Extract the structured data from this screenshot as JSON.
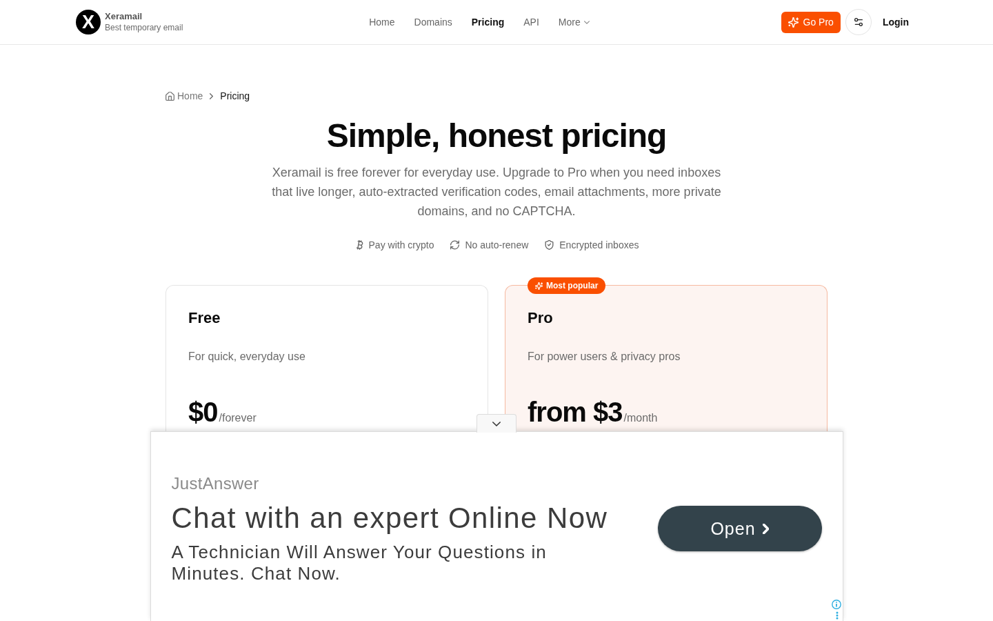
{
  "header": {
    "brand": {
      "logo_letter": "X",
      "name": "Xeramail",
      "tagline": "Best temporary email"
    },
    "nav": [
      {
        "label": "Home",
        "selected": false,
        "kind": "link"
      },
      {
        "label": "Domains",
        "selected": false,
        "kind": "link"
      },
      {
        "label": "Pricing",
        "selected": true,
        "kind": "link"
      },
      {
        "label": "API",
        "selected": false,
        "kind": "link"
      },
      {
        "label": "More",
        "selected": false,
        "kind": "dropdown"
      }
    ],
    "go_pro_button": "Go Pro",
    "login_button": "Login"
  },
  "breadcrumb": [
    {
      "label": "Home",
      "kind": "home"
    },
    {
      "label": "Pricing",
      "kind": "current"
    }
  ],
  "hero": {
    "title": "Simple, honest pricing",
    "description": "Xeramail is free forever for everyday use. Upgrade to Pro when you need inboxes that live longer, auto-extracted verification codes, email attachments, more private domains, and no CAPTCHA."
  },
  "features": [
    {
      "label": "Pay with crypto",
      "kind": "crypto"
    },
    {
      "label": "No auto-renew",
      "kind": "renewal"
    },
    {
      "label": "Encrypted inboxes",
      "kind": "security"
    }
  ],
  "plans": [
    {
      "name": "Free",
      "description": "For quick, everyday use",
      "price": "$0",
      "period": "/forever",
      "featured": false
    },
    {
      "name": "Pro",
      "description": "For power users & privacy pros",
      "price": "from $3",
      "period": "/month",
      "featured": true,
      "badge": "Most popular"
    }
  ],
  "ad": {
    "advertiser": "JustAnswer",
    "headline": "Chat with an expert Online Now",
    "body": "A Technician Will Answer Your Questions in Minutes. Chat Now.",
    "button": "Open"
  }
}
